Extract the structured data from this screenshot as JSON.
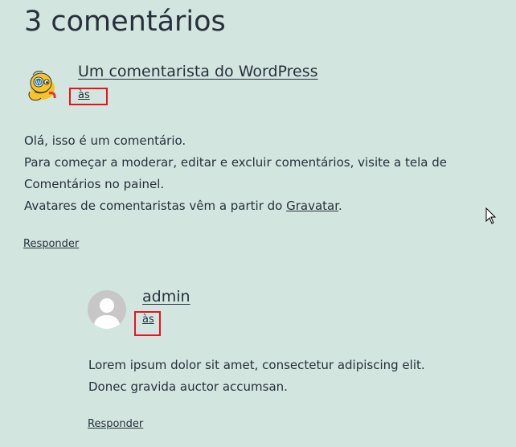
{
  "heading": "3 comentários",
  "comments": [
    {
      "author": "Um comentarista do WordPress",
      "date_link": "às",
      "avatar_icon": "wapuu-avatar-icon",
      "body": [
        "Olá, isso é um comentário.",
        "Para começar a moderar, editar e excluir comentários, visite a tela de",
        "Comentários no painel.",
        "Avatares de comentaristas vêm a partir do "
      ],
      "gravatar_link": "Gravatar",
      "body_end": ".",
      "reply": "Responder"
    },
    {
      "author": "admin",
      "date_link": "às",
      "avatar_icon": "default-user-avatar-icon",
      "body": [
        "Lorem ipsum dolor sit amet, consectetur adipiscing elit.",
        "Donec gravida auctor accumsan."
      ],
      "reply": "Responder"
    }
  ],
  "colors": {
    "background": "#d2e5de",
    "text": "#28303d",
    "highlight_box": "#e8131f"
  }
}
